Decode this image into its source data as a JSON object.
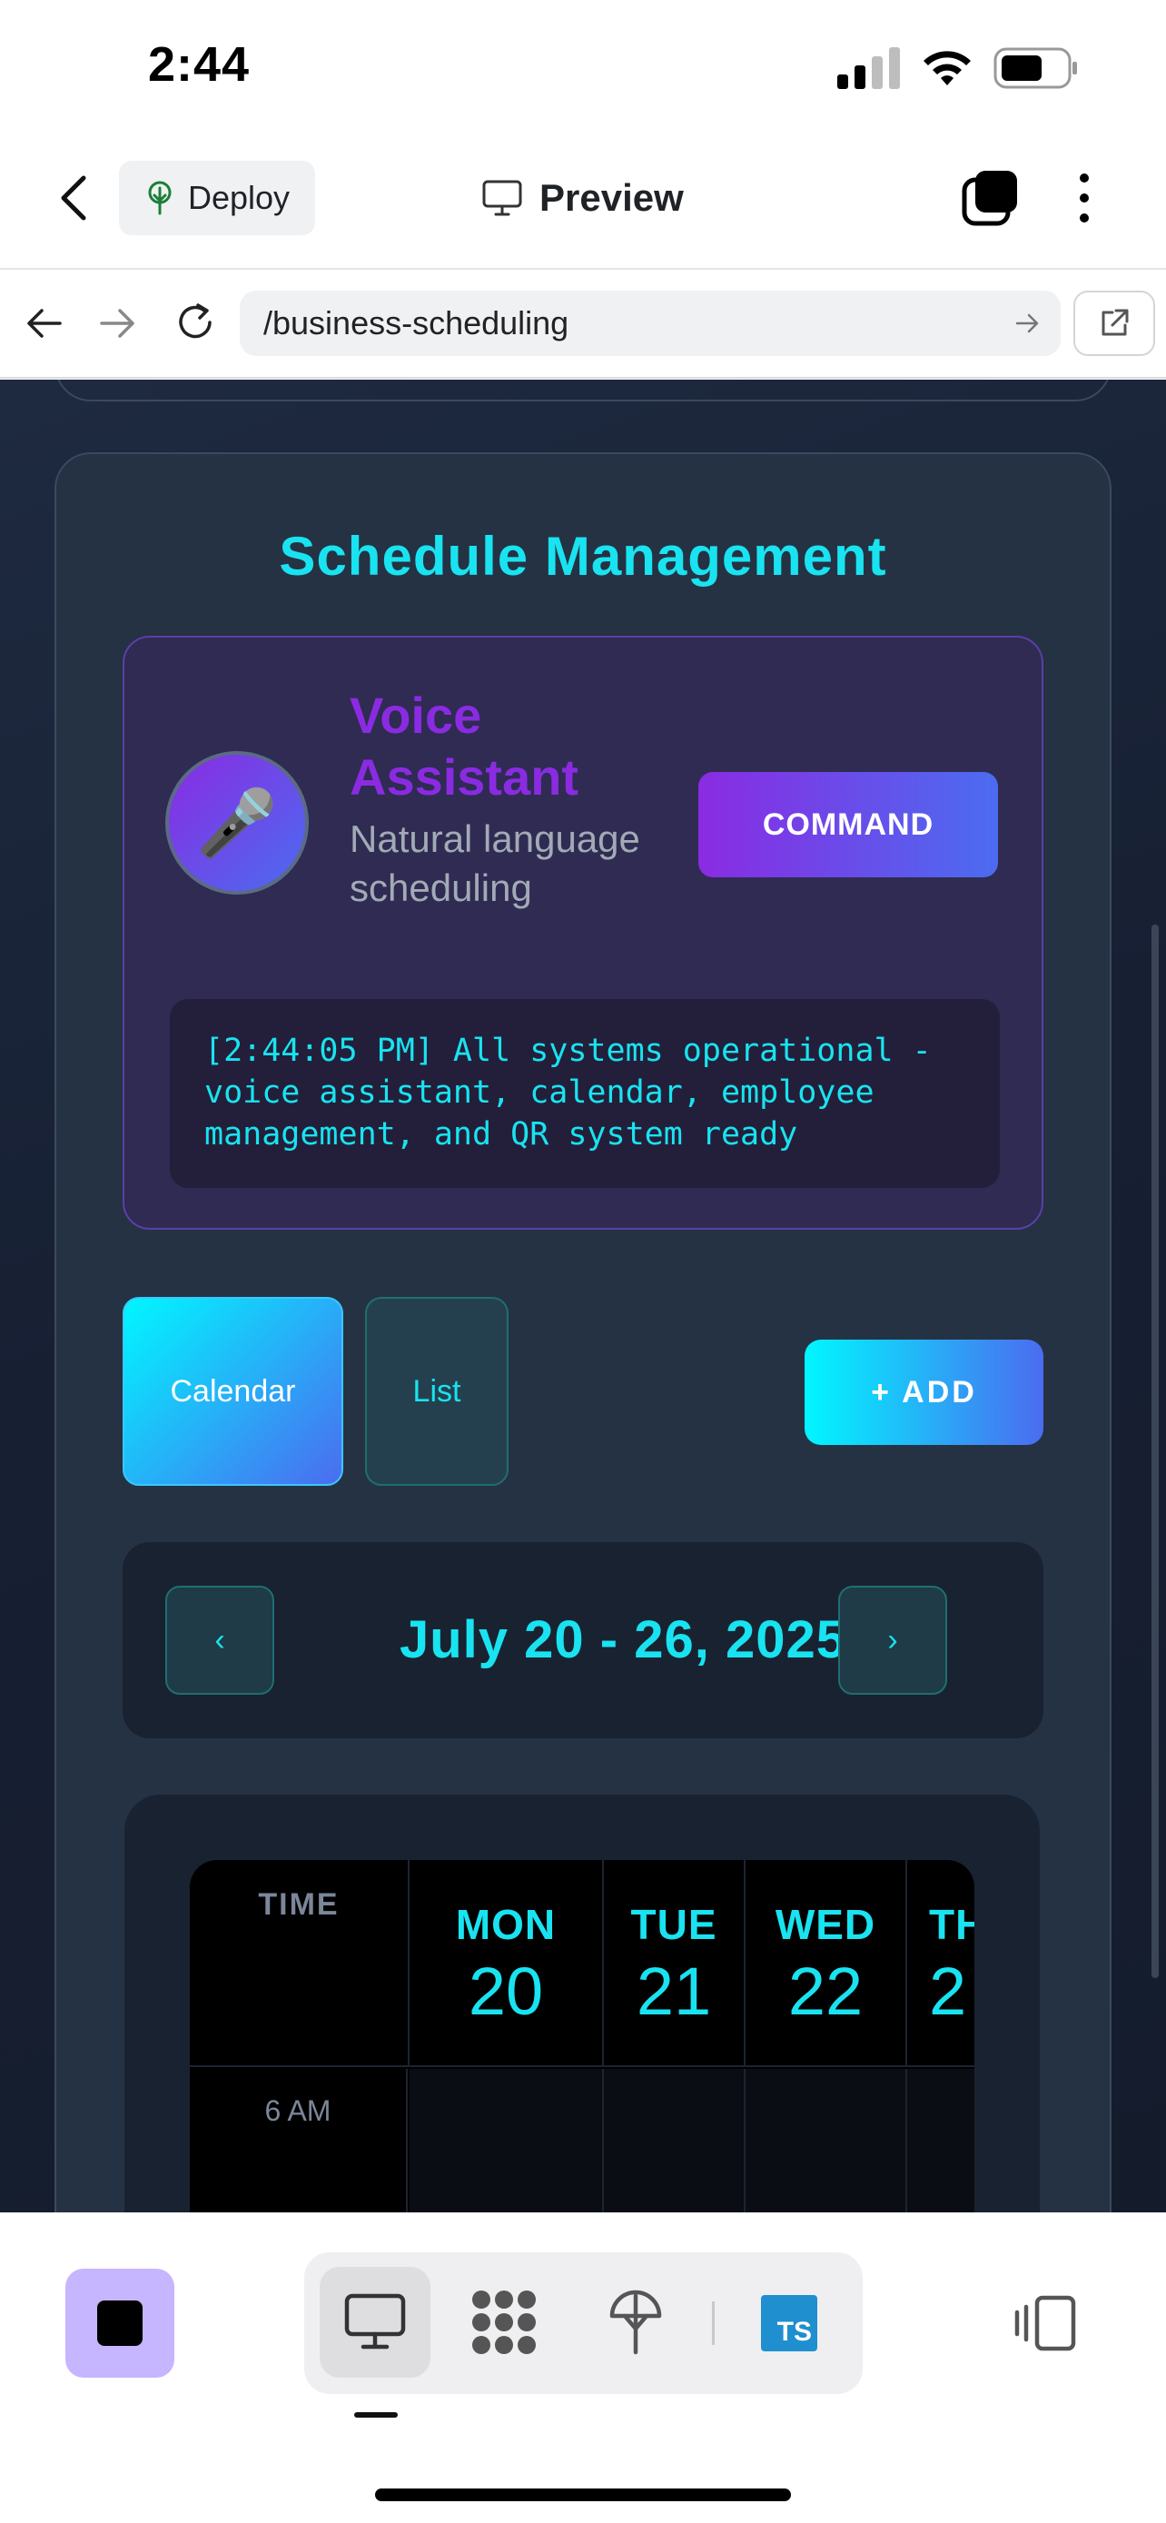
{
  "status_bar": {
    "time": "2:44"
  },
  "app_bar": {
    "deploy_label": "Deploy",
    "preview_label": "Preview"
  },
  "url_bar": {
    "url": "/business-scheduling"
  },
  "page": {
    "title": "Schedule Management",
    "voice": {
      "title": "Voice Assistant",
      "subtitle": "Natural language scheduling",
      "command_label": "COMMAND",
      "log": "[2:44:05 PM] All systems operational - voice assistant, calendar, employee management, and QR system ready"
    },
    "view_tabs": {
      "calendar": "Calendar",
      "list": "List"
    },
    "add_label": "+ ADD",
    "week": {
      "prev": "‹",
      "next": "›",
      "title": "July 20 - 26, 2025"
    },
    "calendar": {
      "time_header": "TIME",
      "days": [
        {
          "name": "MON",
          "num": "20"
        },
        {
          "name": "TUE",
          "num": "21"
        },
        {
          "name": "WED",
          "num": "22"
        },
        {
          "name": "TH",
          "num": "2"
        }
      ],
      "rows": [
        "6 AM"
      ]
    }
  },
  "bottom_bar": {
    "ts_badge": "TS"
  }
}
